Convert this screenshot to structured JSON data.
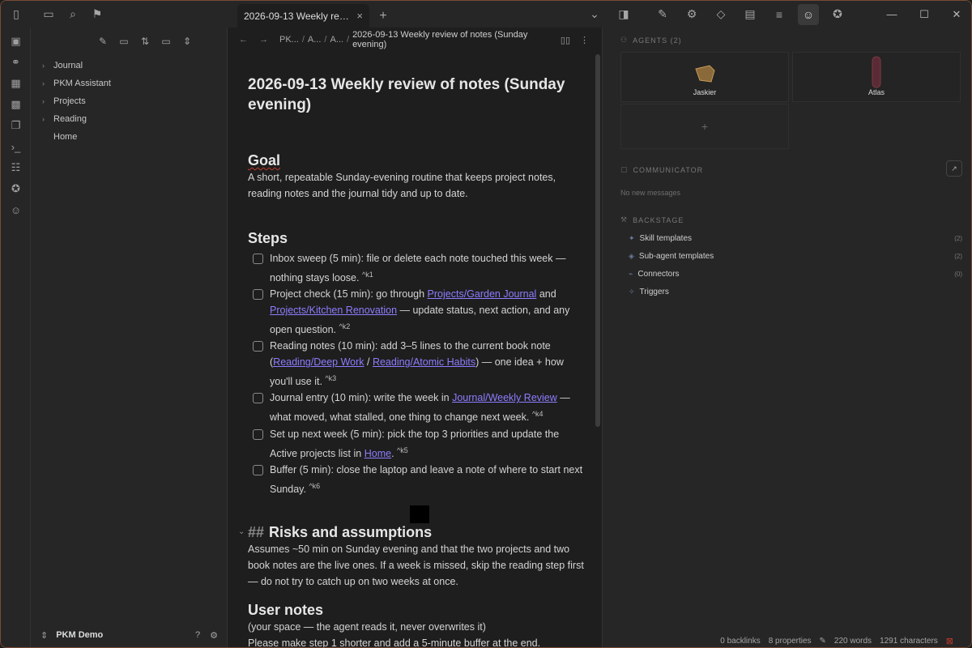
{
  "titlebar": {
    "tab_title": "2026-09-13 Weekly review...",
    "tab_close": "×",
    "tab_add": "+"
  },
  "sidebar": {
    "tree": [
      {
        "label": "Journal",
        "chev": "›"
      },
      {
        "label": "PKM Assistant",
        "chev": "›"
      },
      {
        "label": "Projects",
        "chev": "›"
      },
      {
        "label": "Reading",
        "chev": "›"
      },
      {
        "label": "Home",
        "chev": ""
      }
    ],
    "vault_name": "PKM Demo"
  },
  "editor": {
    "breadcrumb": [
      "PK...",
      "A...",
      "A..."
    ],
    "breadcrumb_current": "2026-09-13 Weekly review of notes (Sunday evening)",
    "doc_title": "2026-09-13 Weekly review of notes (Sunday evening)",
    "goal_heading": "Goal",
    "goal_text": "A short, repeatable Sunday-evening routine that keeps project notes, reading notes and the journal tidy and up to date.",
    "steps_heading": "Steps",
    "steps": [
      {
        "pre": "Inbox sweep (5 min): file or delete each note touched this week — nothing stays loose.",
        "ref": "^k1"
      },
      {
        "pre": "Project check (15 min): go through ",
        "link1": "Projects/Garden Journal",
        "mid": " and ",
        "link2": "Projects/Kitchen Renovation",
        "post": " — update status, next action, and any open question.",
        "ref": "^k2"
      },
      {
        "pre": "Reading notes (10 min): add 3–5 lines to the current book note (",
        "link1": "Reading/Deep Work",
        "mid": " / ",
        "link2": "Reading/Atomic Habits",
        "post": ") — one idea + how you'll use it.",
        "ref": "^k3"
      },
      {
        "pre": "Journal entry (10 min): write the week in ",
        "link1": "Journal/Weekly Review",
        "post": " — what moved, what stalled, one thing to change next week.",
        "ref": "^k4"
      },
      {
        "pre": "Set up next week (5 min): pick the top 3 priorities and update the Active projects list in ",
        "link1": "Home",
        "post": ".",
        "ref": "^k5"
      },
      {
        "pre": "Buffer (5 min): close the laptop and leave a note of where to start next Sunday.",
        "ref": "^k6"
      }
    ],
    "risks_hash": "##",
    "risks_heading": "Risks and assumptions",
    "risks_text": "Assumes ~50 min on Sunday evening and that the two projects and two book notes are the live ones. If a week is missed, skip the reading step first — do not try to catch up on two weeks at once.",
    "user_heading": "User notes",
    "user_line1": "(your space — the agent reads it, never overwrites it)",
    "user_line2": "Please make step 1 shorter and add a 5-minute buffer at the end."
  },
  "rpanel": {
    "agents_label": "AGENTS",
    "agents_count": "(2)",
    "agents": [
      {
        "name": "Jaskier"
      },
      {
        "name": "Atlas"
      }
    ],
    "add_label": "+",
    "communicator_label": "COMMUNICATOR",
    "no_messages": "No new messages",
    "backstage_label": "BACKSTAGE",
    "backstage_items": [
      {
        "label": "Skill templates",
        "count": "(2)"
      },
      {
        "label": "Sub-agent templates",
        "count": "(2)"
      },
      {
        "label": "Connectors",
        "count": "(0)"
      },
      {
        "label": "Triggers",
        "count": ""
      }
    ]
  },
  "statusbar": {
    "backlinks": "0 backlinks",
    "properties": "8 properties",
    "words": "220 words",
    "characters": "1291 characters"
  },
  "colors": {
    "accent_link": "#8d7dff",
    "frame_border": "#7a4a35",
    "spell_underline": "#c0392b"
  }
}
